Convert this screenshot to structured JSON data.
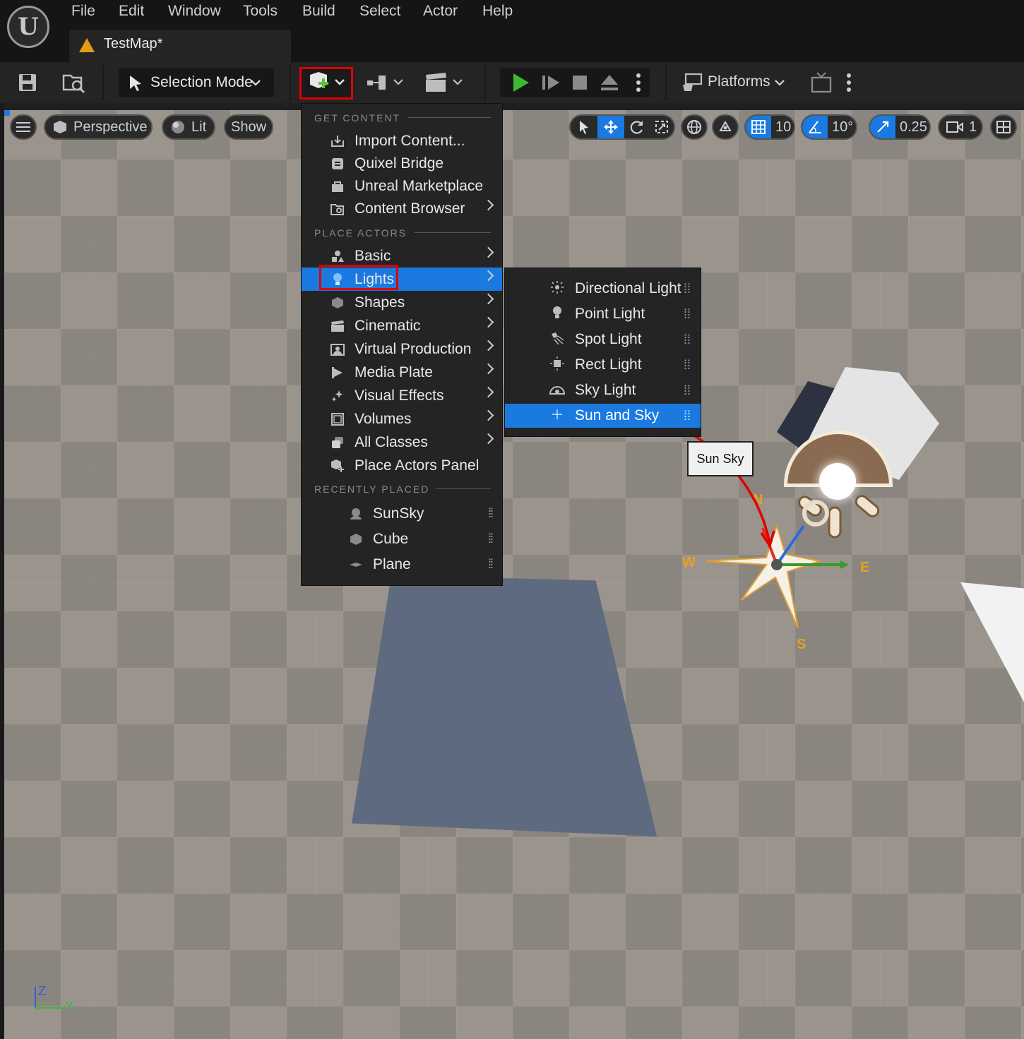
{
  "app": {
    "logo_glyph": "U"
  },
  "menubar": [
    "File",
    "Edit",
    "Window",
    "Tools",
    "Build",
    "Select",
    "Actor",
    "Help"
  ],
  "tab": {
    "title": "TestMap*"
  },
  "toolbar": {
    "selection_mode": "Selection Mode",
    "platforms": "Platforms"
  },
  "viewport": {
    "perspective": "Perspective",
    "lit": "Lit",
    "show": "Show",
    "grid_snap": "10",
    "rotation_snap": "10°",
    "scale_snap": "0.25",
    "camera_speed": "1",
    "tooltip": "Sun Sky",
    "compass": {
      "n": "N",
      "e": "E",
      "s": "S",
      "w": "W"
    },
    "axis": {
      "z": "Z",
      "y": "Y"
    }
  },
  "add_menu": {
    "sections": {
      "get_content": "GET CONTENT",
      "place_actors": "PLACE ACTORS",
      "recently_placed": "RECENTLY PLACED"
    },
    "get_content": [
      "Import Content...",
      "Quixel Bridge",
      "Unreal Marketplace",
      "Content Browser"
    ],
    "place_actors": [
      "Basic",
      "Lights",
      "Shapes",
      "Cinematic",
      "Virtual Production",
      "Media Plate",
      "Visual Effects",
      "Volumes",
      "All Classes",
      "Place Actors Panel"
    ],
    "recently_placed": [
      "SunSky",
      "Cube",
      "Plane"
    ],
    "highlighted": "Lights"
  },
  "lights_submenu": {
    "items": [
      "Directional Light",
      "Point Light",
      "Spot Light",
      "Rect Light",
      "Sky Light",
      "Sun and Sky"
    ],
    "highlighted": "Sun and Sky"
  },
  "colors": {
    "accent": "#1a7ae0",
    "annotation": "#e00000",
    "play": "#3cb832"
  }
}
